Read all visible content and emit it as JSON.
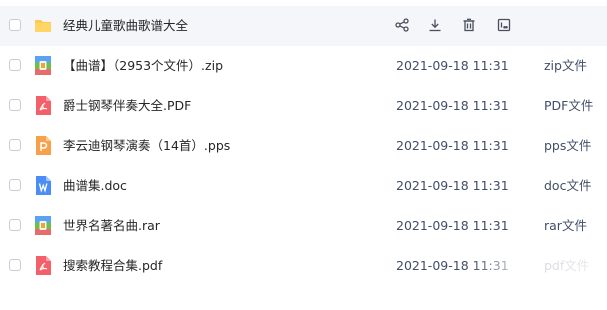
{
  "files": [
    {
      "name": "经典儿童歌曲歌谱大全",
      "date": "",
      "type": "",
      "icon": "folder-icon",
      "hover": true
    },
    {
      "name": "【曲谱】（2953个文件）.zip",
      "date": "2021-09-18 11:31",
      "type": "zip文件",
      "icon": "zip-icon"
    },
    {
      "name": "爵士钢琴伴奏大全.PDF",
      "date": "2021-09-18 11:31",
      "type": "PDF文件",
      "icon": "pdf-icon"
    },
    {
      "name": "李云迪钢琴演奏（14首）.pps",
      "date": "2021-09-18 11:31",
      "type": "pps文件",
      "icon": "pps-icon"
    },
    {
      "name": "曲谱集.doc",
      "date": "2021-09-18 11:31",
      "type": "doc文件",
      "icon": "doc-icon"
    },
    {
      "name": "世界名著名曲.rar",
      "date": "2021-09-18 11:31",
      "type": "rar文件",
      "icon": "rar-icon"
    },
    {
      "name": "搜索教程合集.pdf",
      "date": "2021-09-18 11:31",
      "type": "pdf文件",
      "icon": "pdf-icon"
    }
  ],
  "row_actions": [
    "share-icon",
    "download-icon",
    "delete-icon",
    "more-icon"
  ],
  "colors": {
    "folder": "#ffc94d",
    "archive_green": "#6cc04a",
    "archive_red": "#e86a6a",
    "archive_blue": "#5aa3f0",
    "pdf": "#f2616a",
    "pps": "#f7a24b",
    "doc": "#4a8ef5",
    "action": "#4a4f5c"
  }
}
